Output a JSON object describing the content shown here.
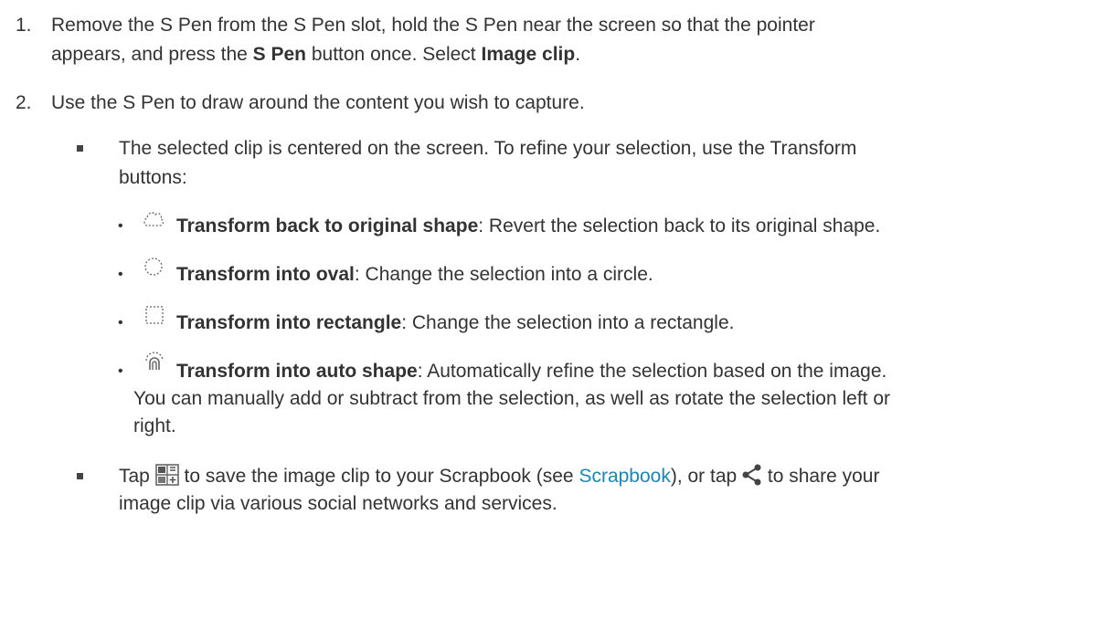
{
  "step1": {
    "number": "1.",
    "line1": "Remove the S Pen from the S Pen slot, hold the S Pen near the screen so that the pointer",
    "line2_a": "appears, and press the ",
    "line2_b": "S Pen",
    "line2_c": " button once. Select ",
    "line2_d": "Image clip",
    "line2_e": "."
  },
  "step2": {
    "number": "2.",
    "text": "Use the S Pen to draw around the content you wish to capture."
  },
  "bullet1": {
    "line1": "The selected clip is centered on the screen. To refine your selection, use the Transform",
    "line2": "buttons:"
  },
  "transforms": [
    {
      "icon": "transform-original-shape-icon",
      "title": "Transform back to original shape",
      "desc": ": Revert the selection back to its original shape."
    },
    {
      "icon": "transform-oval-icon",
      "title": "Transform into oval",
      "desc": ": Change the selection into a circle."
    },
    {
      "icon": "transform-rectangle-icon",
      "title": "Transform into rectangle",
      "desc": ": Change the selection into a rectangle."
    },
    {
      "icon": "transform-auto-shape-icon",
      "title": "Transform into auto shape",
      "desc": ": Automatically refine the selection based on the image.",
      "line2": "You can manually add or subtract from the selection, as well as rotate the selection left or",
      "line3": "right."
    }
  ],
  "bullet2": {
    "a": "Tap ",
    "b": " to save the image clip to your Scrapbook (see ",
    "link": "Scrapbook",
    "c": "), or tap ",
    "d": " to share your",
    "line2": "image clip via various social networks and services."
  },
  "colors": {
    "text": "#333333",
    "link": "#1a87b8",
    "bullet": "#444444"
  }
}
